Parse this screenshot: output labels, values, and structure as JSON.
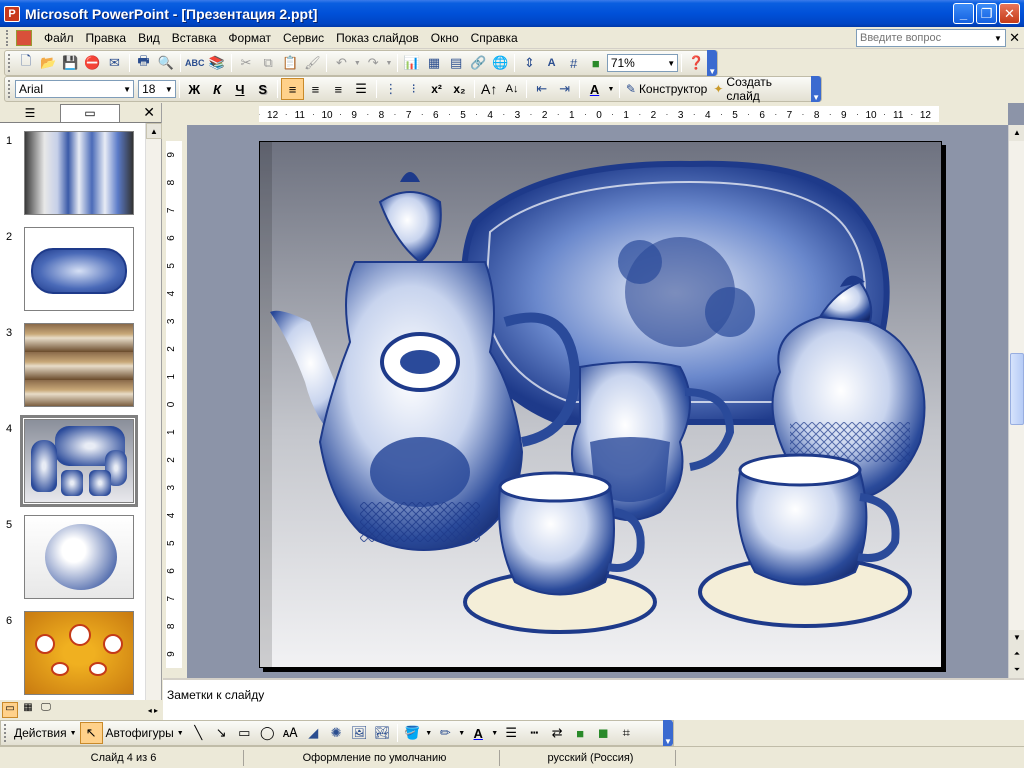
{
  "window": {
    "title": "Microsoft PowerPoint - [Презентация 2.ppt]",
    "app_icon": "powerpoint-icon",
    "controls": [
      "_",
      "❐",
      "✕"
    ]
  },
  "menubar": {
    "items": [
      "Файл",
      "Правка",
      "Вид",
      "Вставка",
      "Формат",
      "Сервис",
      "Показ слайдов",
      "Окно",
      "Справка"
    ],
    "help_placeholder": "Введите вопрос"
  },
  "standard_toolbar": {
    "zoom": "71%"
  },
  "format_toolbar": {
    "font": "Arial",
    "size": "18",
    "bold": "Ж",
    "italic": "К",
    "underline": "Ч",
    "shadow": "S",
    "designer_label": "Конструктор",
    "new_slide_label": "Создать слайд"
  },
  "left_pane": {
    "slides": [
      {
        "number": "1",
        "desc": "blue panels wall"
      },
      {
        "number": "2",
        "desc": "blue tray"
      },
      {
        "number": "3",
        "desc": "showcase shelves"
      },
      {
        "number": "4",
        "desc": "tea set"
      },
      {
        "number": "5",
        "desc": "porcelain pig"
      },
      {
        "number": "6",
        "desc": "orange tea set"
      }
    ],
    "selected": 4
  },
  "notes": {
    "placeholder": "Заметки к слайду"
  },
  "draw_toolbar": {
    "actions_label": "Действия",
    "autoshapes_label": "Автофигуры"
  },
  "statusbar": {
    "slide": "Слайд 4 из 6",
    "design": "Оформление по умолчанию",
    "language": "русский (Россия)"
  },
  "colors": {
    "title_blue": "#0050d8",
    "workspace": "#8c94a8",
    "gzhel_blue": "#1e3a8a"
  },
  "ruler": {
    "horizontal": [
      "12",
      "11",
      "10",
      "9",
      "8",
      "7",
      "6",
      "5",
      "4",
      "3",
      "2",
      "1",
      "0",
      "1",
      "2",
      "3",
      "4",
      "5",
      "6",
      "7",
      "8",
      "9",
      "10",
      "11",
      "12"
    ],
    "vertical": [
      "9",
      "8",
      "7",
      "6",
      "5",
      "4",
      "3",
      "2",
      "1",
      "0",
      "1",
      "2",
      "3",
      "4",
      "5",
      "6",
      "7",
      "8",
      "9"
    ]
  }
}
